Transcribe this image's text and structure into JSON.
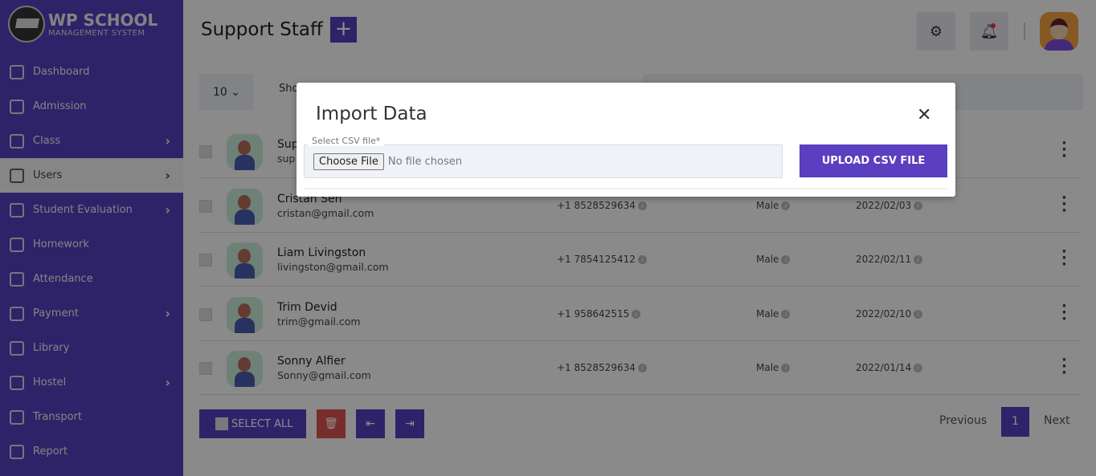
{
  "brand": {
    "line1": "WP SCHOOL",
    "line2": "MANAGEMENT SYSTEM"
  },
  "sidebar": {
    "items": [
      {
        "label": "Dashboard",
        "icon": "grid-icon",
        "chevron": false
      },
      {
        "label": "Admission",
        "icon": "form-icon",
        "chevron": false
      },
      {
        "label": "Class",
        "icon": "classroom-icon",
        "chevron": true
      },
      {
        "label": "Users",
        "icon": "user-icon",
        "chevron": true,
        "active": true
      },
      {
        "label": "Student Evaluation",
        "icon": "clipboard-icon",
        "chevron": true
      },
      {
        "label": "Homework",
        "icon": "book-icon",
        "chevron": false
      },
      {
        "label": "Attendance",
        "icon": "check-icon",
        "chevron": false
      },
      {
        "label": "Payment",
        "icon": "wallet-icon",
        "chevron": true
      },
      {
        "label": "Library",
        "icon": "library-icon",
        "chevron": false
      },
      {
        "label": "Hostel",
        "icon": "building-icon",
        "chevron": true
      },
      {
        "label": "Transport",
        "icon": "bus-icon",
        "chevron": false
      },
      {
        "label": "Report",
        "icon": "report-icon",
        "chevron": false
      }
    ]
  },
  "header": {
    "title": "Support Staff",
    "add": "+"
  },
  "toolbar": {
    "length": "10",
    "show": "Sho"
  },
  "rows": [
    {
      "name": "Sup",
      "email": "sup",
      "phone": "",
      "gender": "",
      "date": ""
    },
    {
      "name": "Cristan Sen",
      "email": "cristan@gmail.com",
      "phone": "+1 8528529634",
      "gender": "Male",
      "date": "2022/02/03"
    },
    {
      "name": "Liam Livingston",
      "email": "livingston@gmail.com",
      "phone": "+1 7854125412",
      "gender": "Male",
      "date": "2022/02/11"
    },
    {
      "name": "Trim Devid",
      "email": "trim@gmail.com",
      "phone": "+1 958642515",
      "gender": "Male",
      "date": "2022/02/10"
    },
    {
      "name": "Sonny Alfier",
      "email": "Sonny@gmail.com",
      "phone": "+1 8528529634",
      "gender": "Male",
      "date": "2022/01/14"
    }
  ],
  "footer": {
    "select_all": "SELECT ALL",
    "previous": "Previous",
    "page": "1",
    "next": "Next"
  },
  "modal": {
    "title": "Import Data",
    "label": "Select CSV file*",
    "choose": "Choose File",
    "no_file": "No file chosen",
    "upload": "UPLOAD CSV FILE"
  },
  "colors": {
    "primary": "#5540c0",
    "delete": "#d9534f"
  }
}
